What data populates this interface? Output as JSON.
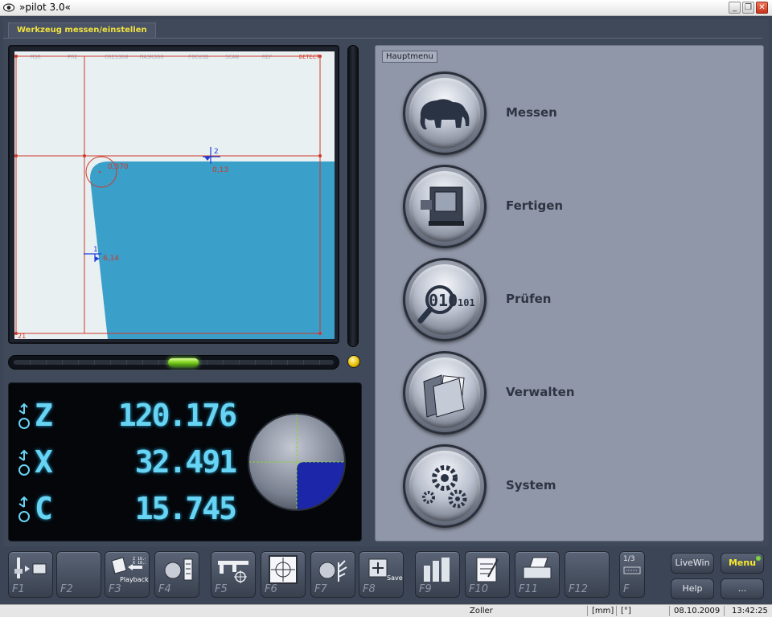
{
  "window": {
    "title": "»pilot 3.0«"
  },
  "tab": {
    "label": "Werkzeug messen/einstellen"
  },
  "camera": {
    "toolbar_labels": [
      "MSR",
      "PRE",
      "CRIS360",
      "MASK360",
      "FOCUSD",
      "SCAN",
      "REF",
      "DETECT"
    ],
    "measure_radius": "0,370",
    "measure_point2_id": "2",
    "measure_point2_value": "0,13",
    "measure_point1_id": "1",
    "measure_point1_value": "6,14",
    "corner_label": "21"
  },
  "dro": {
    "axes": [
      {
        "name": "Z",
        "value": "120.176"
      },
      {
        "name": "X",
        "value": "32.491"
      },
      {
        "name": "C",
        "value": "15.745"
      }
    ]
  },
  "menu": {
    "heading": "Hauptmenu",
    "items": [
      {
        "label": "Messen",
        "icon": "elephant-icon"
      },
      {
        "label": "Fertigen",
        "icon": "machine-icon"
      },
      {
        "label": "Prüfen",
        "icon": "magnifier-binary-icon"
      },
      {
        "label": "Verwalten",
        "icon": "folder-icon"
      },
      {
        "label": "System",
        "icon": "gears-icon"
      }
    ]
  },
  "fkeys": [
    {
      "label": "F1",
      "icon": "tool-transfer-icon"
    },
    {
      "label": "F2",
      "icon": ""
    },
    {
      "label": "F3",
      "icon": "playback-icon",
      "sub": "Playback"
    },
    {
      "label": "F4",
      "icon": "tool-list-icon"
    },
    {
      "label": "F5",
      "icon": "caliper-icon"
    },
    {
      "label": "F6",
      "icon": "crosshair-icon"
    },
    {
      "label": "F7",
      "icon": "tool-tree-icon"
    },
    {
      "label": "F8",
      "icon": "save-icon",
      "sub": "Save"
    },
    {
      "label": "F9",
      "icon": "tool-holders-icon"
    },
    {
      "label": "F10",
      "icon": "notepad-icon"
    },
    {
      "label": "F11",
      "icon": "printer-icon"
    },
    {
      "label": "F12",
      "icon": ""
    },
    {
      "label": "F",
      "icon": "page-icon",
      "sub": "1/3"
    }
  ],
  "right_buttons": {
    "livewin": "LiveWin",
    "menu": "Menu",
    "help": "Help",
    "more": "..."
  },
  "status": {
    "company": "Zoller",
    "unit_mm": "[mm]",
    "unit_deg": "[°]",
    "date": "08.10.2009",
    "time": "13:42:25"
  }
}
